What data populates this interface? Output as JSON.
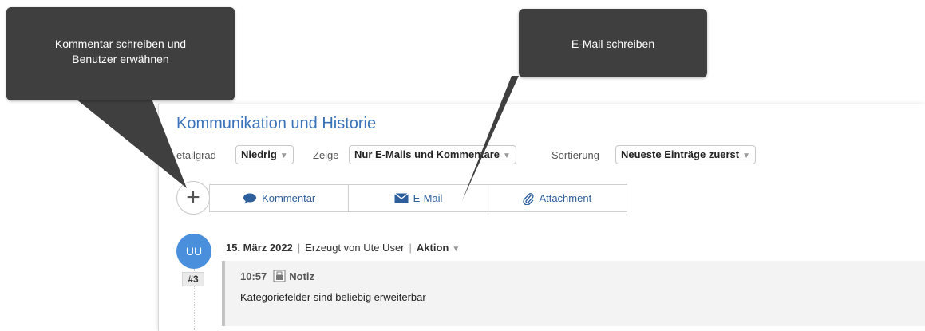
{
  "section": {
    "title": "Kommunikation und Historie"
  },
  "filters": {
    "detail_label": "etailgrad",
    "detail_value": "Niedrig",
    "show_label": "Zeige",
    "show_value": "Nur E-Mails und Kommentare",
    "sort_label": "Sortierung",
    "sort_value": "Neueste Einträge zuerst"
  },
  "actions": {
    "add_symbol": "+",
    "comment_label": "Kommentar",
    "email_label": "E-Mail",
    "attachment_label": "Attachment"
  },
  "entry": {
    "avatar_initials": "UU",
    "number": "#3",
    "date": "15. März 2022",
    "created_by": "Erzeugt von Ute User",
    "action_label": "Aktion",
    "time": "10:57",
    "type": "Notiz",
    "text": "Kategoriefelder sind beliebig erweiterbar"
  },
  "callouts": {
    "comment_line1": "Kommentar schreiben und",
    "comment_line2": "Benutzer erwähnen",
    "email": "E-Mail schreiben"
  },
  "colors": {
    "accent": "#3a73b9",
    "avatar": "#4a8fdc",
    "callout_bg": "#3f3f3f",
    "link": "#2d5f9c"
  },
  "icons": {
    "comment": "speech-bubble-icon",
    "email": "envelope-icon",
    "attachment": "paperclip-icon",
    "caret": "caret-down-icon",
    "note": "note-icon"
  }
}
